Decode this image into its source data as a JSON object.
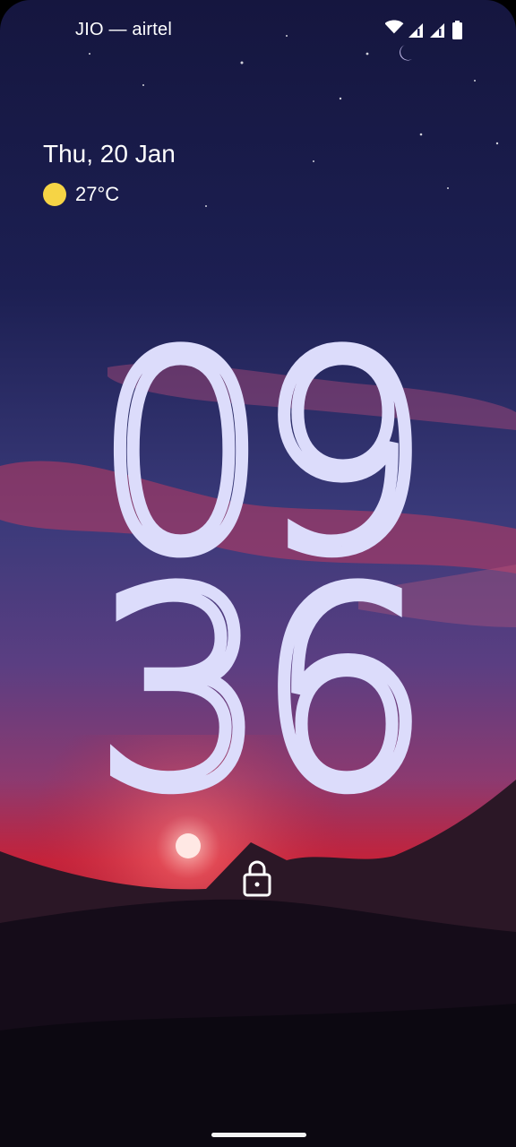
{
  "status_bar": {
    "carrier": "JIO — airtel",
    "icons": [
      "wifi-icon",
      "signal-icon",
      "signal-icon",
      "battery-icon"
    ]
  },
  "lockscreen": {
    "date": "Thu, 20 Jan",
    "weather": {
      "icon": "sun-icon",
      "temperature": "27°C"
    },
    "clock": {
      "hours": "09",
      "minutes": "36"
    },
    "lock_icon": "lock-icon"
  },
  "colors": {
    "clock": "#dcdcfb",
    "sun": "#f6d445",
    "sky_top": "#15163f",
    "sky_horizon": "#c4223a"
  }
}
